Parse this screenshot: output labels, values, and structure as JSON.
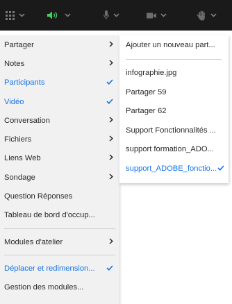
{
  "toolbar": {
    "items": [
      {
        "icon": "apps-grid-icon"
      },
      {
        "icon": "speaker-icon"
      },
      {
        "icon": "microphone-icon"
      },
      {
        "icon": "camera-icon"
      },
      {
        "icon": "raise-hand-icon"
      }
    ],
    "colors": {
      "background": "#1a1a1a",
      "active": "#3fd15b",
      "inactive": "#6d6d6d"
    }
  },
  "menu": {
    "items": [
      {
        "label": "Partager",
        "arrow": true,
        "checked": false
      },
      {
        "label": "Notes",
        "arrow": true,
        "checked": false
      },
      {
        "label": "Participants",
        "arrow": false,
        "checked": true
      },
      {
        "label": "Vidéo",
        "arrow": false,
        "checked": true
      },
      {
        "label": "Conversation",
        "arrow": true,
        "checked": false
      },
      {
        "label": "Fichiers",
        "arrow": true,
        "checked": false
      },
      {
        "label": "Liens Web",
        "arrow": true,
        "checked": false
      },
      {
        "label": "Sondage",
        "arrow": true,
        "checked": false
      },
      {
        "label": "Question Réponses",
        "arrow": false,
        "checked": false
      },
      {
        "label": "Tableau de bord d'occup...",
        "arrow": false,
        "checked": false
      },
      {
        "label": "Modules d'atelier",
        "arrow": true,
        "checked": false
      },
      {
        "label": "Déplacer et redimension...",
        "arrow": false,
        "checked": true
      },
      {
        "label": "Gestion des modules...",
        "arrow": false,
        "checked": false
      }
    ]
  },
  "submenu": {
    "add_label": "Ajouter un nouveau part...",
    "items": [
      {
        "label": "infographie.jpg",
        "checked": false
      },
      {
        "label": "Partager 59",
        "checked": false
      },
      {
        "label": "Partager 62",
        "checked": false
      },
      {
        "label": "Support Fonctionnalités ...",
        "checked": false
      },
      {
        "label": "support formation_ADO...",
        "checked": false
      },
      {
        "label": "support_ADOBE_fonctio...",
        "checked": true
      }
    ]
  },
  "colors": {
    "accent": "#1473e6",
    "menu_bg": "#f1f1f1",
    "submenu_bg": "#ffffff",
    "text": "#2a2a2a"
  }
}
